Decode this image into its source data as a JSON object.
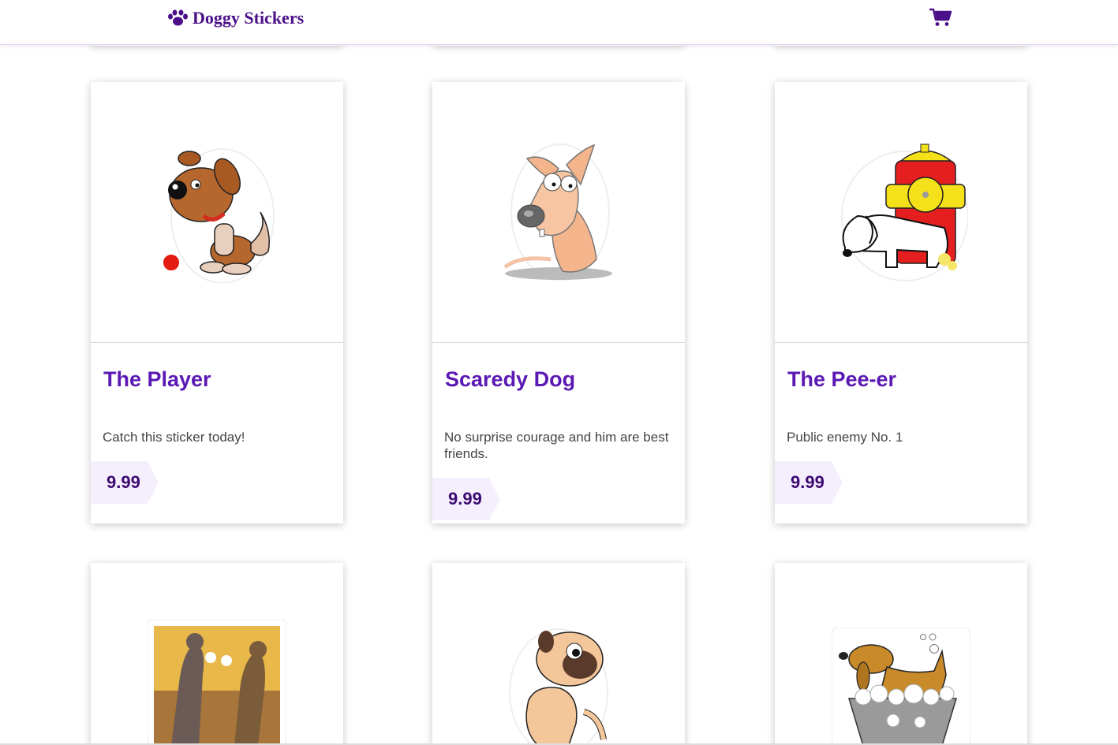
{
  "brand": {
    "title": "Doggy Stickers",
    "icon": "paw-icon"
  },
  "nav": {
    "cart_icon": "shopping-cart-icon"
  },
  "colors": {
    "accent": "#5b19b4",
    "brand": "#4b0f8a",
    "price_bg": "#f5effd"
  },
  "products": [
    {
      "title": "The Player",
      "description": "Catch this sticker today!",
      "price": "9.99",
      "icon": "dog-with-ball-sticker"
    },
    {
      "title": "Scaredy Dog",
      "description": "No surprise courage and him are best friends.",
      "price": "9.99",
      "icon": "scared-dog-sticker"
    },
    {
      "title": "The Pee-er",
      "description": "Public enemy No. 1",
      "price": "9.99",
      "icon": "dog-at-hydrant-sticker"
    }
  ],
  "partial_products": [
    {
      "icon": "boxing-dogs-sticker"
    },
    {
      "icon": "pug-sticker"
    },
    {
      "icon": "dog-in-bath-sticker"
    }
  ]
}
